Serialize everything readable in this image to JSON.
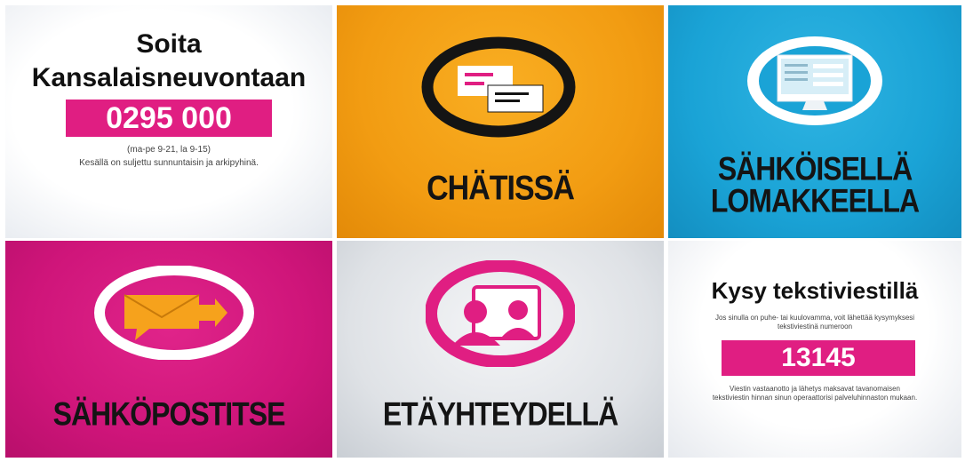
{
  "tiles": {
    "phone": {
      "heading_line1": "Soita",
      "heading_line2": "Kansalaisneuvontaan",
      "number": "0295 000",
      "hours": "(ma-pe 9-21, la 9-15)",
      "note": "Kesällä on suljettu sunnuntaisin ja arkipyhinä.",
      "background": "#ffffff",
      "accent": "#e01e82"
    },
    "chat": {
      "label": "CHÄTISSÄ",
      "icon": "chat-bubbles-icon",
      "background": "#f29c12"
    },
    "form": {
      "label_line1": "SÄHKÖISELLÄ",
      "label_line2": "LOMAKKEELLA",
      "icon": "computer-monitor-icon",
      "background": "#1aa3d6"
    },
    "email": {
      "label": "SÄHKÖPOSTITSE",
      "icon": "envelope-icon",
      "background": "#cf157a"
    },
    "remote": {
      "label": "ETÄYHTEYDELLÄ",
      "icon": "video-call-icon",
      "background": "#dfe2e6",
      "accent": "#e01e82"
    },
    "sms": {
      "heading": "Kysy tekstiviestillä",
      "intro": "Jos sinulla on puhe- tai kuulovamma, voit lähettää kysymyksesi tekstiviestinä numeroon",
      "number": "13145",
      "footnote": "Viestin vastaanotto ja lähetys maksavat tavanomaisen tekstiviestin hinnan sinun operaattorisi palveluhinnaston mukaan.",
      "background": "#ffffff",
      "accent": "#e01e82"
    }
  }
}
